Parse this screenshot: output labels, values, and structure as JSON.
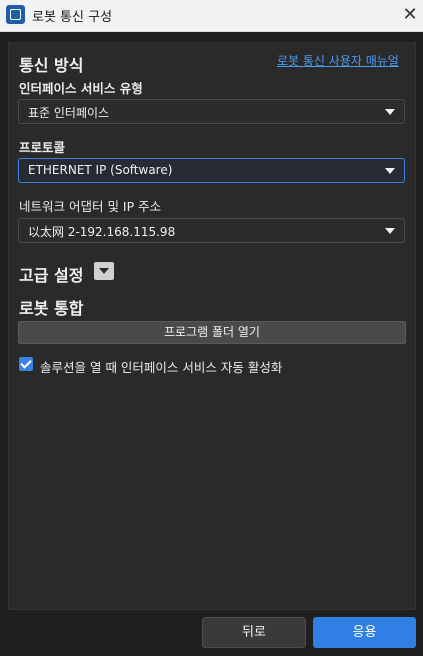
{
  "window": {
    "title": "로봇 통신 구성"
  },
  "comm": {
    "heading": "통신 방식",
    "manual_link": "로봇 통신 사용자 매뉴얼",
    "interface_type_label": "인터페이스 서비스 유형",
    "interface_type_value": "표준 인터페이스",
    "protocol_label": "프로토콜",
    "protocol_value": "ETHERNET IP (Software)",
    "adapter_label": "네트워크 어댑터 및 IP 주소",
    "adapter_value": "以太网 2-192.168.115.98"
  },
  "advanced": {
    "heading": "고급 설정"
  },
  "integration": {
    "heading": "로봇 통합",
    "open_folder_label": "프로그램 폴더 열기",
    "auto_activate_label": "솔루션을 열 때 인터페이스 서비스 자동 활성화",
    "auto_activate_checked": true
  },
  "footer": {
    "back_label": "뒤로",
    "apply_label": "응용"
  },
  "colors": {
    "accent": "#2f7fe4",
    "link": "#4a9bf0",
    "background": "#1f1f1f",
    "panel": "#2a2a2a"
  }
}
